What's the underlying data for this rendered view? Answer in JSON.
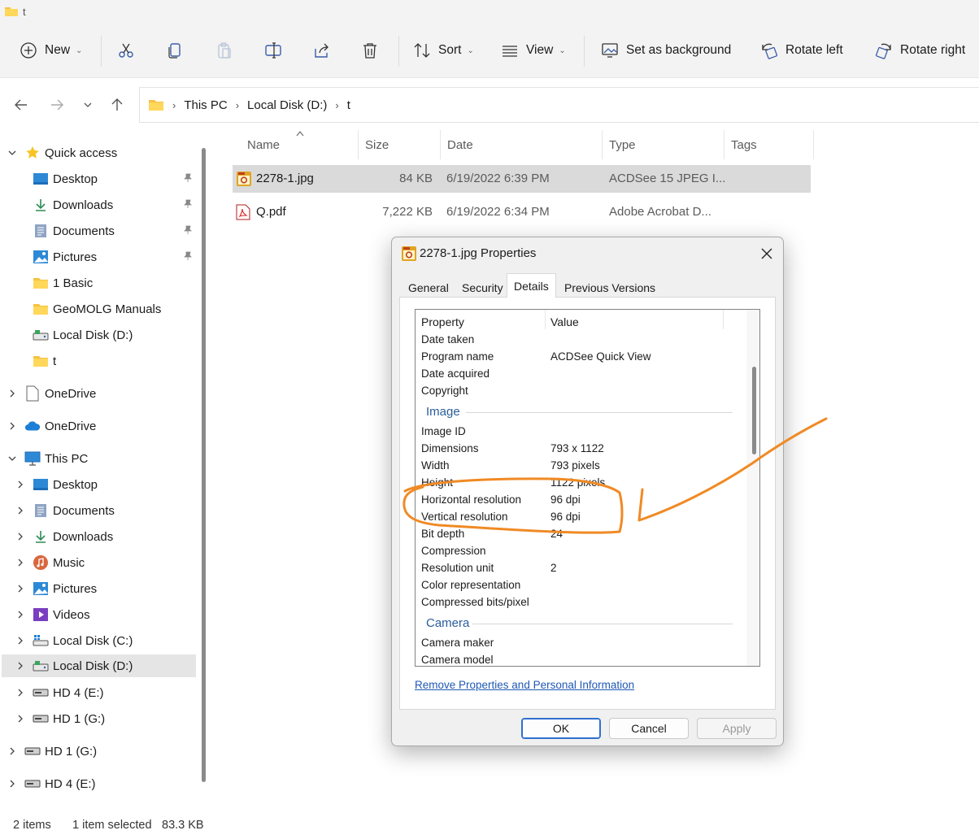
{
  "window": {
    "title": "t"
  },
  "toolbar": {
    "new_label": "New",
    "sort_label": "Sort",
    "view_label": "View",
    "set_bg_label": "Set as background",
    "rotate_left_label": "Rotate left",
    "rotate_right_label": "Rotate right"
  },
  "breadcrumb": [
    "This PC",
    "Local Disk (D:)",
    "t"
  ],
  "sidebar": {
    "quick_access": "Quick access",
    "quick_items": [
      "Desktop",
      "Downloads",
      "Documents",
      "Pictures",
      "1 Basic",
      "GeoMOLG Manuals",
      "Local Disk (D:)",
      "t"
    ],
    "onedrive_1": "OneDrive",
    "onedrive_2": "OneDrive",
    "this_pc": "This PC",
    "pc_items": [
      "Desktop",
      "Documents",
      "Downloads",
      "Music",
      "Pictures",
      "Videos",
      "Local Disk (C:)",
      "Local Disk (D:)",
      "HD 4 (E:)",
      "HD 1 (G:)"
    ],
    "bottom_items": [
      "HD 1 (G:)",
      "HD 4 (E:)"
    ]
  },
  "columns": {
    "name": "Name",
    "size": "Size",
    "date": "Date",
    "type": "Type",
    "tags": "Tags"
  },
  "files": [
    {
      "name": "2278-1.jpg",
      "size": "84 KB",
      "date": "6/19/2022 6:39 PM",
      "type": "ACDSee 15 JPEG I..."
    },
    {
      "name": "Q.pdf",
      "size": "7,222 KB",
      "date": "6/19/2022 6:34 PM",
      "type": "Adobe Acrobat D..."
    }
  ],
  "status": {
    "items": "2 items",
    "selected": "1 item selected",
    "size": "83.3 KB"
  },
  "dialog": {
    "title": "2278-1.jpg Properties",
    "tabs": [
      "General",
      "Security",
      "Details",
      "Previous Versions"
    ],
    "header_property": "Property",
    "header_value": "Value",
    "rows_top": [
      {
        "p": "Date taken",
        "v": ""
      },
      {
        "p": "Program name",
        "v": "ACDSee Quick View"
      },
      {
        "p": "Date acquired",
        "v": ""
      },
      {
        "p": "Copyright",
        "v": ""
      }
    ],
    "group_image": "Image",
    "rows_image": [
      {
        "p": "Image ID",
        "v": ""
      },
      {
        "p": "Dimensions",
        "v": "793 x 1122"
      },
      {
        "p": "Width",
        "v": "793 pixels"
      },
      {
        "p": "Height",
        "v": "1122 pixels"
      },
      {
        "p": "Horizontal resolution",
        "v": "96 dpi"
      },
      {
        "p": "Vertical resolution",
        "v": "96 dpi"
      },
      {
        "p": "Bit depth",
        "v": "24"
      },
      {
        "p": "Compression",
        "v": ""
      },
      {
        "p": "Resolution unit",
        "v": "2"
      },
      {
        "p": "Color representation",
        "v": ""
      },
      {
        "p": "Compressed bits/pixel",
        "v": ""
      }
    ],
    "group_camera": "Camera",
    "rows_camera": [
      {
        "p": "Camera maker",
        "v": ""
      },
      {
        "p": "Camera model",
        "v": ""
      }
    ],
    "remove_link": "Remove Properties and Personal Information",
    "ok": "OK",
    "cancel": "Cancel",
    "apply": "Apply"
  },
  "colors": {
    "annotation": "#f08a24",
    "link": "#1f58b5",
    "group": "#2a5d9a",
    "selected_row": "#dadada"
  }
}
